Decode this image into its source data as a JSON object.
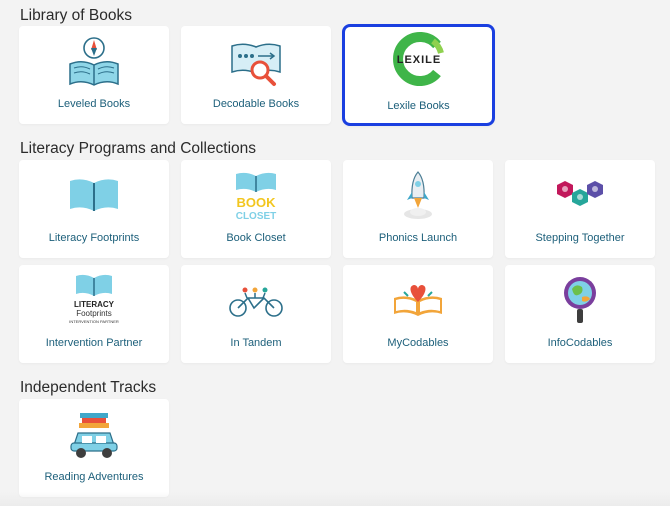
{
  "sections": {
    "library": {
      "title": "Library of Books",
      "cards": [
        {
          "label": "Leveled Books",
          "icon": "leveled-books-icon"
        },
        {
          "label": "Decodable Books",
          "icon": "decodable-books-icon"
        },
        {
          "label": "Lexile Books",
          "icon": "lexile-logo-icon",
          "logo_text": "LEXILE",
          "selected": true
        }
      ]
    },
    "programs": {
      "title": "Literacy Programs and Collections",
      "cards": [
        {
          "label": "Literacy Footprints",
          "icon": "open-book-icon"
        },
        {
          "label": "Book Closet",
          "icon": "book-closet-logo-icon",
          "logo_line1": "BOOK",
          "logo_line2": "CLOSET"
        },
        {
          "label": "Phonics Launch",
          "icon": "rocket-icon"
        },
        {
          "label": "Stepping Together",
          "icon": "hexagons-icon"
        },
        {
          "label": "Intervention Partner",
          "icon": "literacy-footprints-logo-icon",
          "logo_line1": "LITERACY",
          "logo_line2": "Footprints",
          "logo_line3": "INTERVENTION PARTNER"
        },
        {
          "label": "In Tandem",
          "icon": "tandem-bicycle-icon"
        },
        {
          "label": "MyCodables",
          "icon": "book-heart-icon"
        },
        {
          "label": "InfoCodables",
          "icon": "magnifier-globe-icon"
        }
      ]
    },
    "independent": {
      "title": "Independent Tracks",
      "cards": [
        {
          "label": "Reading Adventures",
          "icon": "car-books-icon"
        }
      ]
    }
  },
  "colors": {
    "background": "#f3f3f3",
    "card": "#ffffff",
    "label": "#1c5f7a",
    "selected_border": "#1a3fe0",
    "title": "#2b2b2b"
  }
}
